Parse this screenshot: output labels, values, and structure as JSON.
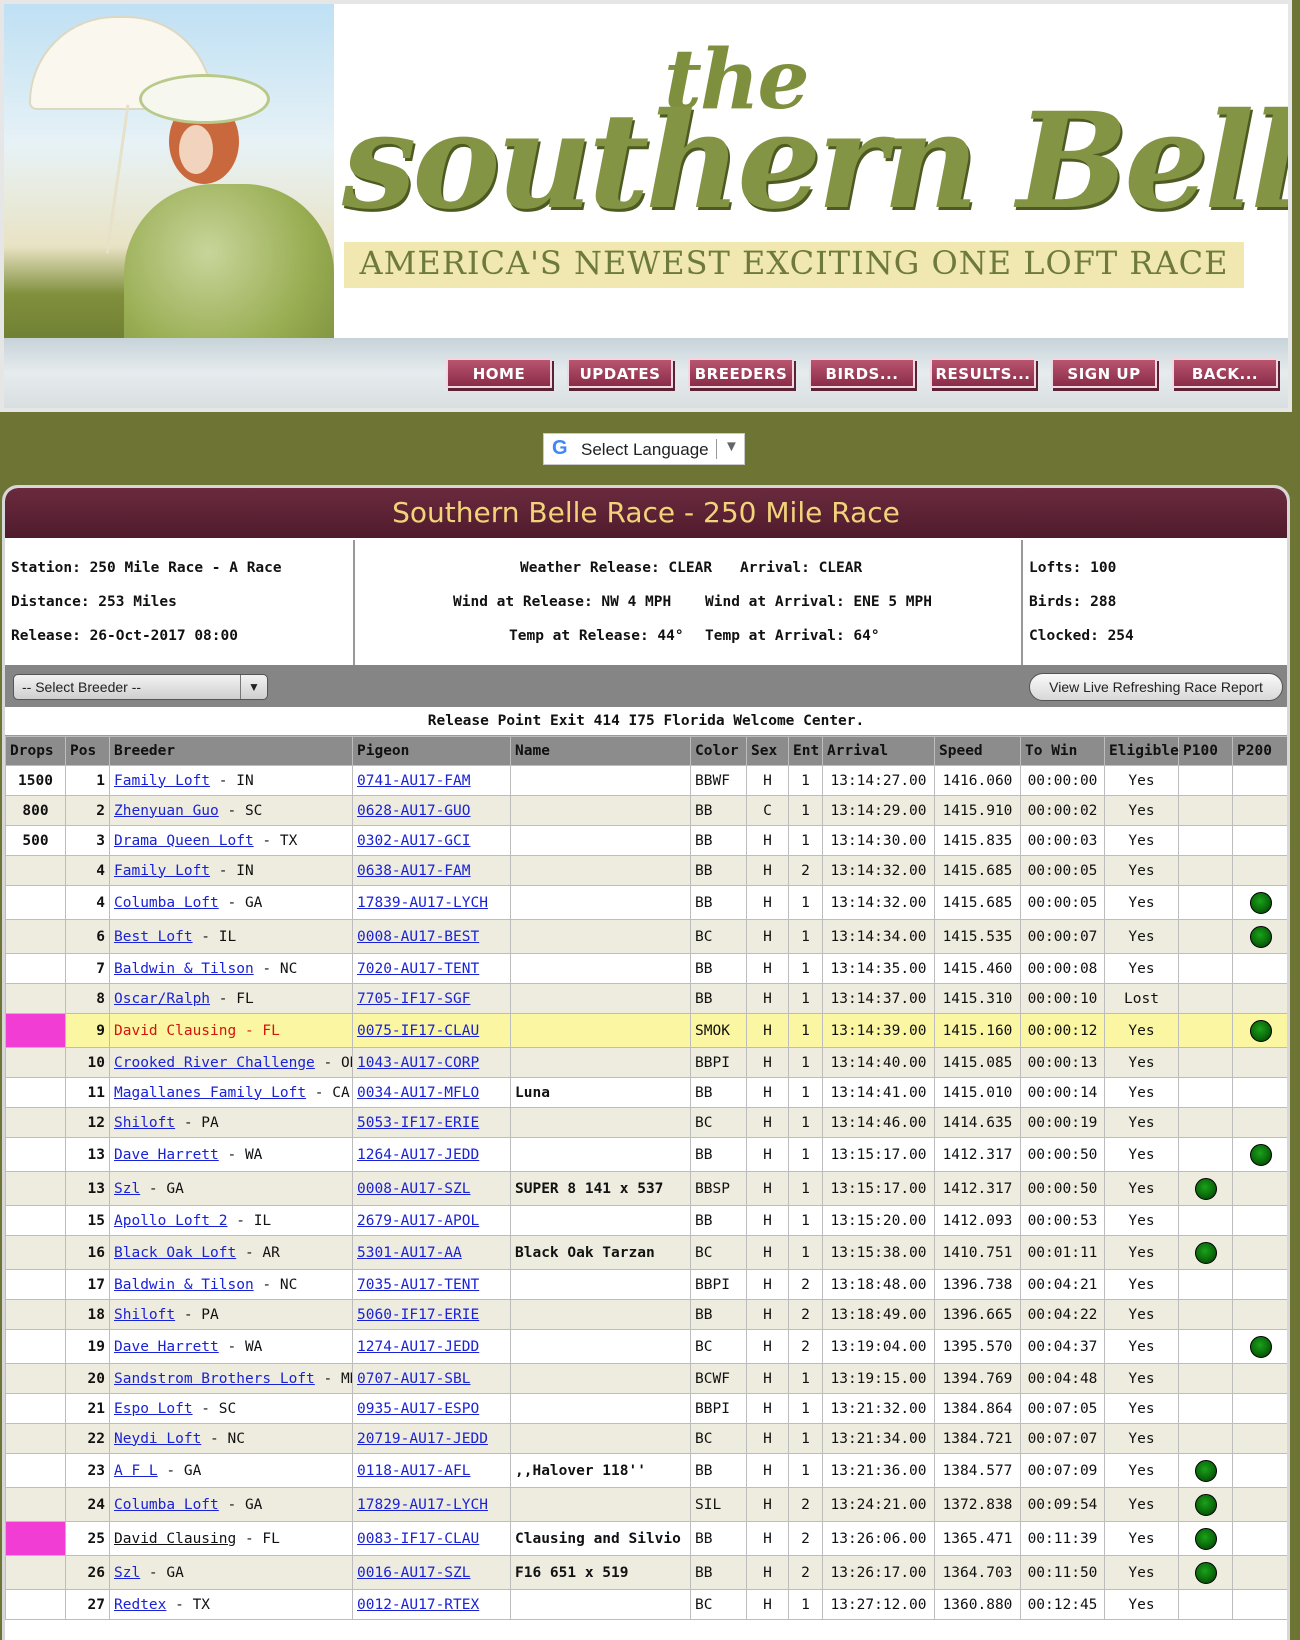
{
  "banner": {
    "title_the": "the",
    "title_main": "southern Belle",
    "tagline": "AMERICA'S NEWEST EXCITING ONE LOFT RACE"
  },
  "nav": [
    "HOME",
    "UPDATES",
    "BREEDERS",
    "BIRDS...",
    "RESULTS...",
    "SIGN UP",
    "BACK..."
  ],
  "language": {
    "g": "G",
    "label": "Select Language",
    "arrow": "▼"
  },
  "race": {
    "title": "Southern Belle Race - 250 Mile Race",
    "station": "Station: 250 Mile Race - A Race",
    "distance": "Distance: 253 Miles",
    "release": "Release: 26-Oct-2017 08:00",
    "weather_release": "Weather Release: CLEAR",
    "arrival": "Arrival: CLEAR",
    "wind_release": "Wind at Release: NW 4 MPH",
    "wind_arrival": "Wind at Arrival: ENE 5 MPH",
    "temp_release": "Temp at Release: 44°",
    "temp_arrival": "Temp at Arrival: 64°",
    "lofts": "Lofts: 100",
    "birds": "Birds: 288",
    "clocked": "Clocked: 254"
  },
  "toolbar": {
    "select_breeder": "-- Select Breeder --",
    "select_arrow": "▼",
    "live_report": "View Live Refreshing Race Report"
  },
  "release_point": "Release Point Exit 414 I75 Florida Welcome Center.",
  "columns": [
    "Drops",
    "Pos",
    "Breeder",
    "Pigeon",
    "Name",
    "Color",
    "Sex",
    "Ent",
    "Arrival",
    "Speed",
    "To Win",
    "Eligible",
    "P100",
    "P200"
  ],
  "rows": [
    {
      "drops": "1500",
      "pos": "1",
      "breeder": "Family Loft",
      "state": " - IN",
      "pigeon": "0741-AU17-FAM",
      "name": "",
      "color": "BBWF",
      "sex": "H",
      "ent": "1",
      "arrival": "13:14:27.00",
      "speed": "1416.060",
      "towin": "00:00:00",
      "eligible": "Yes",
      "p100": false,
      "p200": false
    },
    {
      "drops": "800",
      "pos": "2",
      "breeder": "Zhenyuan Guo",
      "state": " - SC",
      "pigeon": "0628-AU17-GUO",
      "name": "",
      "color": "BB",
      "sex": "C",
      "ent": "1",
      "arrival": "13:14:29.00",
      "speed": "1415.910",
      "towin": "00:00:02",
      "eligible": "Yes",
      "p100": false,
      "p200": false
    },
    {
      "drops": "500",
      "pos": "3",
      "breeder": "Drama Queen Loft",
      "state": " - TX",
      "pigeon": "0302-AU17-GCI",
      "name": "",
      "color": "BB",
      "sex": "H",
      "ent": "1",
      "arrival": "13:14:30.00",
      "speed": "1415.835",
      "towin": "00:00:03",
      "eligible": "Yes",
      "p100": false,
      "p200": false
    },
    {
      "drops": "",
      "pos": "4",
      "breeder": "Family Loft",
      "state": " - IN",
      "pigeon": "0638-AU17-FAM",
      "name": "",
      "color": "BB",
      "sex": "H",
      "ent": "2",
      "arrival": "13:14:32.00",
      "speed": "1415.685",
      "towin": "00:00:05",
      "eligible": "Yes",
      "p100": false,
      "p200": false
    },
    {
      "drops": "",
      "pos": "4",
      "breeder": "Columba Loft",
      "state": " - GA",
      "pigeon": "17839-AU17-LYCH",
      "name": "",
      "color": "BB",
      "sex": "H",
      "ent": "1",
      "arrival": "13:14:32.00",
      "speed": "1415.685",
      "towin": "00:00:05",
      "eligible": "Yes",
      "p100": false,
      "p200": true
    },
    {
      "drops": "",
      "pos": "6",
      "breeder": "Best Loft",
      "state": " - IL",
      "pigeon": "0008-AU17-BEST",
      "name": "",
      "color": "BC",
      "sex": "H",
      "ent": "1",
      "arrival": "13:14:34.00",
      "speed": "1415.535",
      "towin": "00:00:07",
      "eligible": "Yes",
      "p100": false,
      "p200": true
    },
    {
      "drops": "",
      "pos": "7",
      "breeder": "Baldwin & Tilson",
      "state": " - NC",
      "pigeon": "7020-AU17-TENT",
      "name": "",
      "color": "BB",
      "sex": "H",
      "ent": "1",
      "arrival": "13:14:35.00",
      "speed": "1415.460",
      "towin": "00:00:08",
      "eligible": "Yes",
      "p100": false,
      "p200": false
    },
    {
      "drops": "",
      "pos": "8",
      "breeder": "Oscar/Ralph",
      "state": " - FL",
      "pigeon": "7705-IF17-SGF",
      "name": "",
      "color": "BB",
      "sex": "H",
      "ent": "1",
      "arrival": "13:14:37.00",
      "speed": "1415.310",
      "towin": "00:00:10",
      "eligible": "Lost",
      "p100": false,
      "p200": false
    },
    {
      "drops": "",
      "pos": "9",
      "breeder": "David Clausing",
      "state": " - FL",
      "pigeon": "0075-IF17-CLAU",
      "name": "",
      "color": "SMOK",
      "sex": "H",
      "ent": "1",
      "arrival": "13:14:39.00",
      "speed": "1415.160",
      "towin": "00:00:12",
      "eligible": "Yes",
      "p100": false,
      "p200": true,
      "highlight": true,
      "mark": true
    },
    {
      "drops": "",
      "pos": "10",
      "breeder": "Crooked River Challenge",
      "state": " - OR",
      "pigeon": "1043-AU17-CORP",
      "name": "",
      "color": "BBPI",
      "sex": "H",
      "ent": "1",
      "arrival": "13:14:40.00",
      "speed": "1415.085",
      "towin": "00:00:13",
      "eligible": "Yes",
      "p100": false,
      "p200": false
    },
    {
      "drops": "",
      "pos": "11",
      "breeder": "Magallanes Family Loft",
      "state": " - CA",
      "pigeon": "0034-AU17-MFLO",
      "name": "Luna",
      "color": "BB",
      "sex": "H",
      "ent": "1",
      "arrival": "13:14:41.00",
      "speed": "1415.010",
      "towin": "00:00:14",
      "eligible": "Yes",
      "p100": false,
      "p200": false
    },
    {
      "drops": "",
      "pos": "12",
      "breeder": "Shiloft",
      "state": " - PA",
      "pigeon": "5053-IF17-ERIE",
      "name": "",
      "color": "BC",
      "sex": "H",
      "ent": "1",
      "arrival": "13:14:46.00",
      "speed": "1414.635",
      "towin": "00:00:19",
      "eligible": "Yes",
      "p100": false,
      "p200": false
    },
    {
      "drops": "",
      "pos": "13",
      "breeder": "Dave Harrett",
      "state": " - WA",
      "pigeon": "1264-AU17-JEDD",
      "name": "",
      "color": "BB",
      "sex": "H",
      "ent": "1",
      "arrival": "13:15:17.00",
      "speed": "1412.317",
      "towin": "00:00:50",
      "eligible": "Yes",
      "p100": false,
      "p200": true
    },
    {
      "drops": "",
      "pos": "13",
      "breeder": "Szl",
      "state": " - GA",
      "pigeon": "0008-AU17-SZL",
      "name": "SUPER 8 141 x 537",
      "color": "BBSP",
      "sex": "H",
      "ent": "1",
      "arrival": "13:15:17.00",
      "speed": "1412.317",
      "towin": "00:00:50",
      "eligible": "Yes",
      "p100": true,
      "p200": false
    },
    {
      "drops": "",
      "pos": "15",
      "breeder": "Apollo Loft 2",
      "state": " - IL",
      "pigeon": "2679-AU17-APOL",
      "name": "",
      "color": "BB",
      "sex": "H",
      "ent": "1",
      "arrival": "13:15:20.00",
      "speed": "1412.093",
      "towin": "00:00:53",
      "eligible": "Yes",
      "p100": false,
      "p200": false
    },
    {
      "drops": "",
      "pos": "16",
      "breeder": "Black Oak Loft",
      "state": " - AR",
      "pigeon": "5301-AU17-AA",
      "name": "Black Oak Tarzan",
      "color": "BC",
      "sex": "H",
      "ent": "1",
      "arrival": "13:15:38.00",
      "speed": "1410.751",
      "towin": "00:01:11",
      "eligible": "Yes",
      "p100": true,
      "p200": false
    },
    {
      "drops": "",
      "pos": "17",
      "breeder": "Baldwin & Tilson",
      "state": " - NC",
      "pigeon": "7035-AU17-TENT",
      "name": "",
      "color": "BBPI",
      "sex": "H",
      "ent": "2",
      "arrival": "13:18:48.00",
      "speed": "1396.738",
      "towin": "00:04:21",
      "eligible": "Yes",
      "p100": false,
      "p200": false
    },
    {
      "drops": "",
      "pos": "18",
      "breeder": "Shiloft",
      "state": " - PA",
      "pigeon": "5060-IF17-ERIE",
      "name": "",
      "color": "BB",
      "sex": "H",
      "ent": "2",
      "arrival": "13:18:49.00",
      "speed": "1396.665",
      "towin": "00:04:22",
      "eligible": "Yes",
      "p100": false,
      "p200": false
    },
    {
      "drops": "",
      "pos": "19",
      "breeder": "Dave Harrett",
      "state": " - WA",
      "pigeon": "1274-AU17-JEDD",
      "name": "",
      "color": "BC",
      "sex": "H",
      "ent": "2",
      "arrival": "13:19:04.00",
      "speed": "1395.570",
      "towin": "00:04:37",
      "eligible": "Yes",
      "p100": false,
      "p200": true
    },
    {
      "drops": "",
      "pos": "20",
      "breeder": "Sandstrom Brothers Loft",
      "state": " - MN",
      "pigeon": "0707-AU17-SBL",
      "name": "",
      "color": "BCWF",
      "sex": "H",
      "ent": "1",
      "arrival": "13:19:15.00",
      "speed": "1394.769",
      "towin": "00:04:48",
      "eligible": "Yes",
      "p100": false,
      "p200": false
    },
    {
      "drops": "",
      "pos": "21",
      "breeder": "Espo Loft",
      "state": " - SC",
      "pigeon": "0935-AU17-ESPO",
      "name": "",
      "color": "BBPI",
      "sex": "H",
      "ent": "1",
      "arrival": "13:21:32.00",
      "speed": "1384.864",
      "towin": "00:07:05",
      "eligible": "Yes",
      "p100": false,
      "p200": false
    },
    {
      "drops": "",
      "pos": "22",
      "breeder": "Neydi Loft",
      "state": " - NC",
      "pigeon": "20719-AU17-JEDD",
      "name": "",
      "color": "BC",
      "sex": "H",
      "ent": "1",
      "arrival": "13:21:34.00",
      "speed": "1384.721",
      "towin": "00:07:07",
      "eligible": "Yes",
      "p100": false,
      "p200": false
    },
    {
      "drops": "",
      "pos": "23",
      "breeder": "A F L",
      "state": " - GA",
      "pigeon": "0118-AU17-AFL",
      "name": ",,Halover 118''",
      "color": "BB",
      "sex": "H",
      "ent": "1",
      "arrival": "13:21:36.00",
      "speed": "1384.577",
      "towin": "00:07:09",
      "eligible": "Yes",
      "p100": true,
      "p200": false
    },
    {
      "drops": "",
      "pos": "24",
      "breeder": "Columba Loft",
      "state": " - GA",
      "pigeon": "17829-AU17-LYCH",
      "name": "",
      "color": "SIL",
      "sex": "H",
      "ent": "2",
      "arrival": "13:24:21.00",
      "speed": "1372.838",
      "towin": "00:09:54",
      "eligible": "Yes",
      "p100": true,
      "p200": false
    },
    {
      "drops": "",
      "pos": "25",
      "breeder": "David Clausing",
      "state": " - FL",
      "pigeon": "0083-IF17-CLAU",
      "name": "Clausing and Silvio",
      "color": "BB",
      "sex": "H",
      "ent": "2",
      "arrival": "13:26:06.00",
      "speed": "1365.471",
      "towin": "00:11:39",
      "eligible": "Yes",
      "p100": true,
      "p200": false,
      "mark": true,
      "plainbreeder": true
    },
    {
      "drops": "",
      "pos": "26",
      "breeder": "Szl",
      "state": " - GA",
      "pigeon": "0016-AU17-SZL",
      "name": "F16 651 x 519",
      "color": "BB",
      "sex": "H",
      "ent": "2",
      "arrival": "13:26:17.00",
      "speed": "1364.703",
      "towin": "00:11:50",
      "eligible": "Yes",
      "p100": true,
      "p200": false
    },
    {
      "drops": "",
      "pos": "27",
      "breeder": "Redtex",
      "state": " - TX",
      "pigeon": "0012-AU17-RTEX",
      "name": "",
      "color": "BC",
      "sex": "H",
      "ent": "1",
      "arrival": "13:27:12.00",
      "speed": "1360.880",
      "towin": "00:12:45",
      "eligible": "Yes",
      "p100": false,
      "p200": false
    }
  ]
}
